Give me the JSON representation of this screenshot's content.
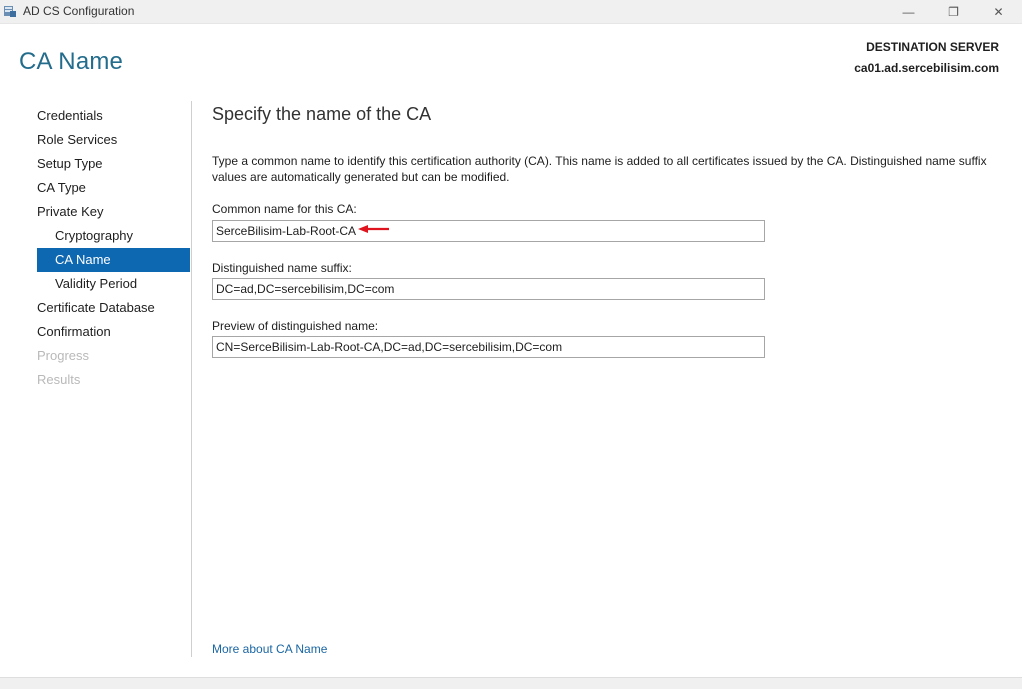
{
  "window": {
    "title": "AD CS Configuration",
    "minimize_glyph": "—",
    "maximize_glyph": "❐",
    "close_glyph": "✕"
  },
  "header": {
    "page_title": "CA Name",
    "destination_label": "DESTINATION SERVER",
    "destination_server": "ca01.ad.sercebilisim.com"
  },
  "nav": {
    "items": [
      {
        "label": "Credentials",
        "state": "normal"
      },
      {
        "label": "Role Services",
        "state": "normal"
      },
      {
        "label": "Setup Type",
        "state": "normal"
      },
      {
        "label": "CA Type",
        "state": "normal"
      },
      {
        "label": "Private Key",
        "state": "normal"
      },
      {
        "label": "Cryptography",
        "state": "sub"
      },
      {
        "label": "CA Name",
        "state": "selected"
      },
      {
        "label": "Validity Period",
        "state": "sub"
      },
      {
        "label": "Certificate Database",
        "state": "normal"
      },
      {
        "label": "Confirmation",
        "state": "normal"
      },
      {
        "label": "Progress",
        "state": "disabled"
      },
      {
        "label": "Results",
        "state": "disabled"
      }
    ]
  },
  "main": {
    "heading": "Specify the name of the CA",
    "description": "Type a common name to identify this certification authority (CA). This name is added to all certificates issued by the CA. Distinguished name suffix values are automatically generated but can be modified.",
    "common_name": {
      "label": "Common name for this CA:",
      "value": "SerceBilisim-Lab-Root-CA"
    },
    "dn_suffix": {
      "label": "Distinguished name suffix:",
      "value": "DC=ad,DC=sercebilisim,DC=com"
    },
    "dn_preview": {
      "label": "Preview of distinguished name:",
      "value": "CN=SerceBilisim-Lab-Root-CA,DC=ad,DC=sercebilisim,DC=com"
    },
    "more_link": "More about CA Name"
  },
  "colors": {
    "accent": "#236c8c",
    "selection": "#0e67b1",
    "annotation_arrow": "#e0141e",
    "link": "#1a66a3"
  }
}
